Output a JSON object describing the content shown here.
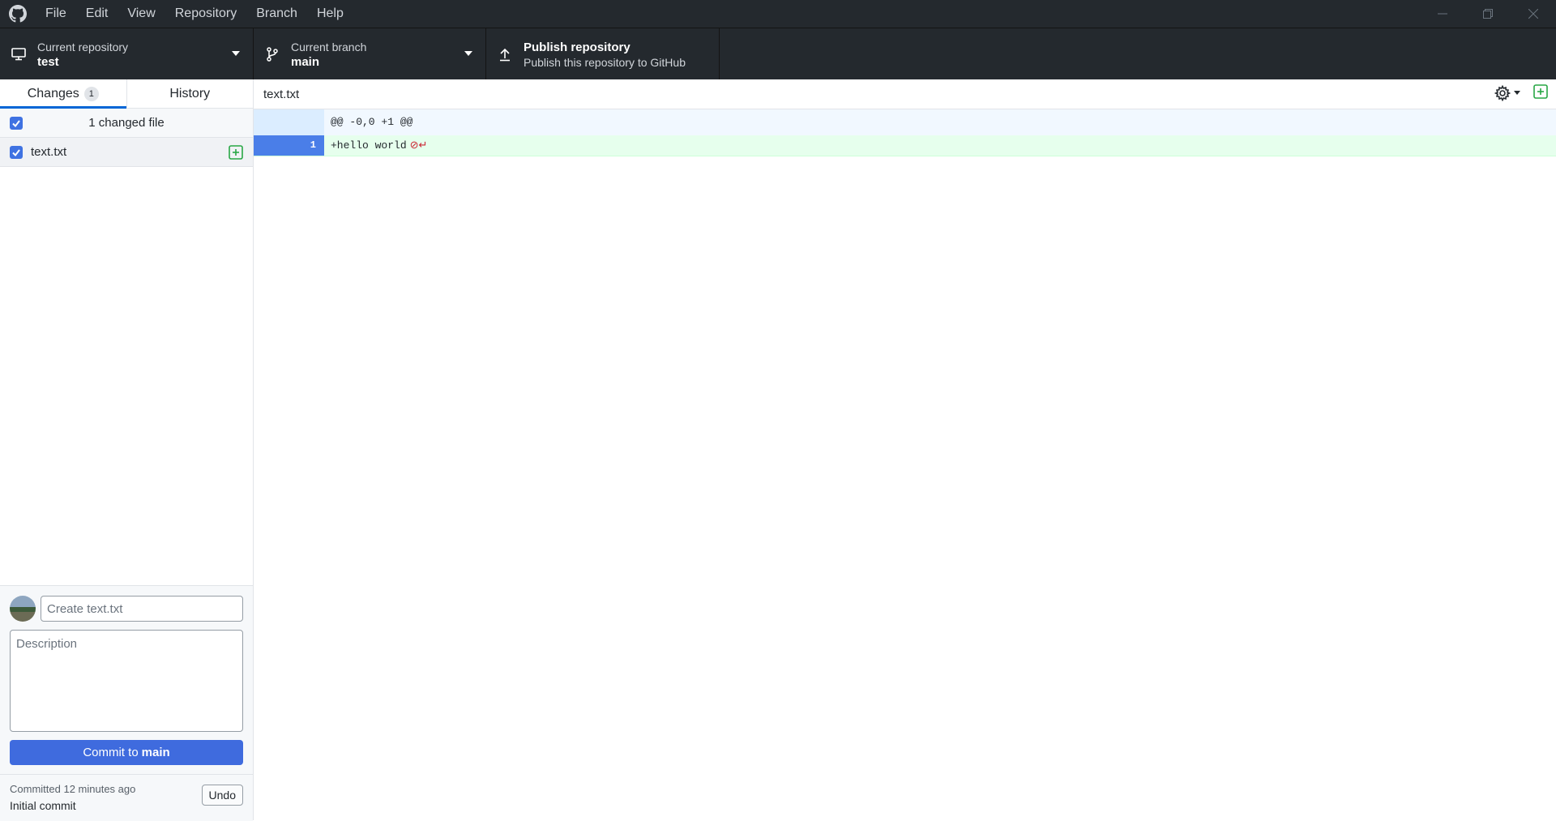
{
  "menu": [
    "File",
    "Edit",
    "View",
    "Repository",
    "Branch",
    "Help"
  ],
  "toolbar": {
    "repo_label": "Current repository",
    "repo_value": "test",
    "branch_label": "Current branch",
    "branch_value": "main",
    "publish_title": "Publish repository",
    "publish_desc": "Publish this repository to GitHub"
  },
  "tabs": {
    "changes_label": "Changes",
    "changes_count": "1",
    "history_label": "History"
  },
  "changes": {
    "header_label": "1 changed file",
    "files": [
      {
        "name": "text.txt",
        "status": "added"
      }
    ]
  },
  "commit": {
    "summary_placeholder": "Create text.txt",
    "description_placeholder": "Description",
    "button_prefix": "Commit to",
    "button_branch": "main"
  },
  "last_commit": {
    "meta": "Committed 12 minutes ago",
    "message": "Initial commit",
    "undo_label": "Undo"
  },
  "diff": {
    "filename": "text.txt",
    "hunk_header": "@@ -0,0 +1 @@",
    "lines": [
      {
        "new_line_number": "1",
        "text": "+hello world",
        "no_newline_marker": "⊘↵"
      }
    ]
  },
  "colors": {
    "accent": "#0366d6",
    "commit_button": "#3f6bde",
    "added_line_bg": "#e6ffed",
    "hunk_bg": "#f1f8ff",
    "titlebar_bg": "#24292e"
  }
}
